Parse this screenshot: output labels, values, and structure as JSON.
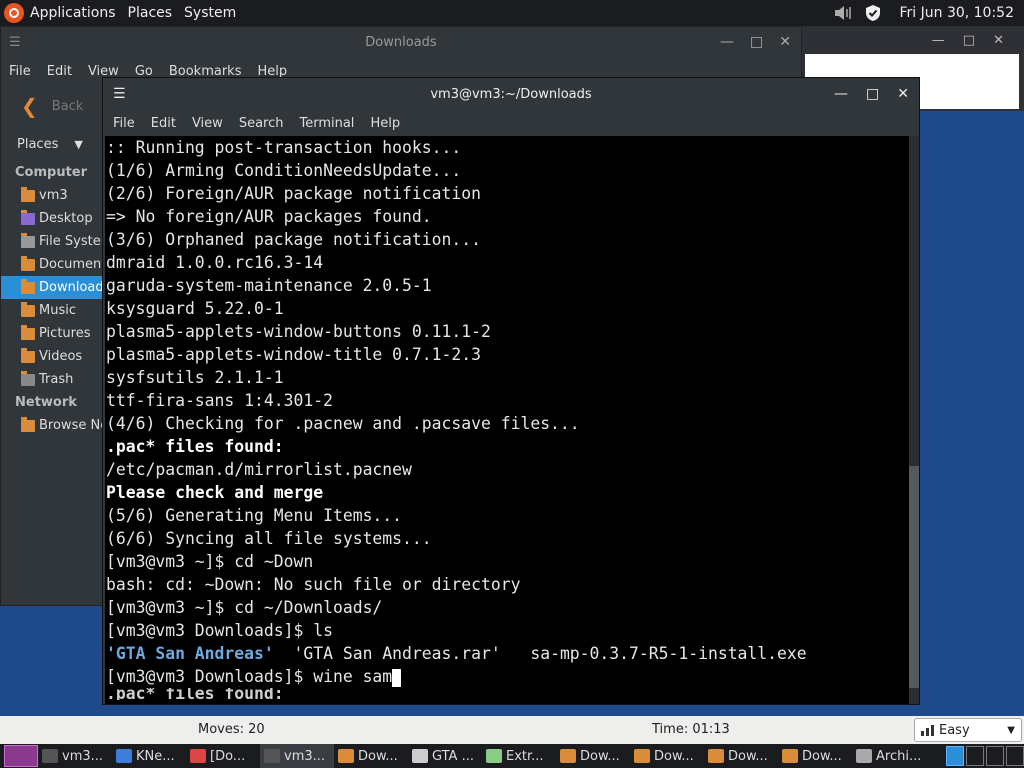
{
  "top_panel": {
    "menus": [
      "Applications",
      "Places",
      "System"
    ],
    "clock": "Fri Jun 30, 10:52"
  },
  "file_manager": {
    "title": "Downloads",
    "menu": [
      "File",
      "Edit",
      "View",
      "Go",
      "Bookmarks",
      "Help"
    ],
    "back_label": "Back",
    "places_label": "Places",
    "sections": [
      {
        "heading": "Computer",
        "items": [
          "vm3",
          "Desktop",
          "File System",
          "Documents",
          "Downloads",
          "Music",
          "Pictures",
          "Videos",
          "Trash"
        ]
      },
      {
        "heading": "Network",
        "items": [
          "Browse Network"
        ]
      }
    ],
    "active_item": "Downloads"
  },
  "terminal": {
    "title": "vm3@vm3:~/Downloads",
    "menu": [
      "File",
      "Edit",
      "View",
      "Search",
      "Terminal",
      "Help"
    ],
    "lines": [
      ":: Running post-transaction hooks...",
      "(1/6) Arming ConditionNeedsUpdate...",
      "(2/6) Foreign/AUR package notification",
      "=> No foreign/AUR packages found.",
      "(3/6) Orphaned package notification...",
      "dmraid 1.0.0.rc16.3-14",
      "garuda-system-maintenance 2.0.5-1",
      "ksysguard 5.22.0-1",
      "plasma5-applets-window-buttons 0.11.1-2",
      "plasma5-applets-window-title 0.7.1-2.3",
      "sysfsutils 2.1.1-1",
      "ttf-fira-sans 1:4.301-2",
      "(4/6) Checking for .pacnew and .pacsave files...",
      ".pac* files found:",
      "/etc/pacman.d/mirrorlist.pacnew",
      "Please check and merge",
      "(5/6) Generating Menu Items...",
      "(6/6) Syncing all file systems...",
      "[vm3@vm3 ~]$ cd ~Down",
      "bash: cd: ~Down: No such file or directory",
      "[vm3@vm3 ~]$ cd ~/Downloads/",
      "[vm3@vm3 Downloads]$ ls"
    ],
    "ls_output": {
      "dir": "'GTA San Andreas'",
      "rest": "  'GTA San Andreas.rar'   sa-mp-0.3.7-R5-1-install.exe"
    },
    "prompt": "[vm3@vm3 Downloads]$ wine sam",
    "ghost_line": ".pac* files found:"
  },
  "statusbar": {
    "moves": "Moves: 20",
    "time": "Time: 01:13",
    "difficulty": "Easy"
  },
  "taskbar": {
    "tasks": [
      {
        "label": "vm3...",
        "icon": "terminal-icon",
        "color": "#555"
      },
      {
        "label": "KNe...",
        "icon": "network-icon",
        "color": "#3b7dd8"
      },
      {
        "label": "[Do...",
        "icon": "chrome-icon",
        "color": "#d44"
      },
      {
        "label": "vm3...",
        "icon": "terminal-icon",
        "color": "#555"
      },
      {
        "label": "Dow...",
        "icon": "folder-icon",
        "color": "#d98c3a"
      },
      {
        "label": "GTA ...",
        "icon": "archive-icon",
        "color": "#ccc"
      },
      {
        "label": "Extr...",
        "icon": "extract-icon",
        "color": "#8c8"
      },
      {
        "label": "Dow...",
        "icon": "folder-icon",
        "color": "#d98c3a"
      },
      {
        "label": "Dow...",
        "icon": "folder-icon",
        "color": "#d98c3a"
      },
      {
        "label": "Dow...",
        "icon": "folder-icon",
        "color": "#d98c3a"
      },
      {
        "label": "Dow...",
        "icon": "folder-icon",
        "color": "#d98c3a"
      },
      {
        "label": "Archi...",
        "icon": "archive-manager-icon",
        "color": "#aaa"
      }
    ],
    "active_index": 3
  }
}
